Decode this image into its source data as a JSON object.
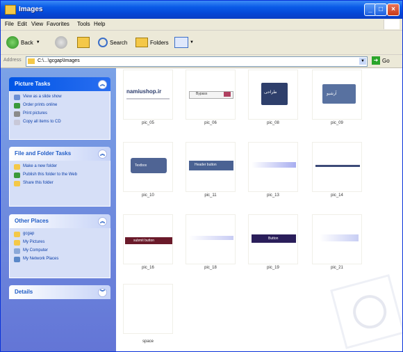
{
  "window": {
    "title": "Images"
  },
  "menu": [
    "File",
    "Edit",
    "View",
    "Favorites",
    "Tools",
    "Help"
  ],
  "toolbar": {
    "back": "Back",
    "search": "Search",
    "folders": "Folders"
  },
  "address": {
    "label": "Address",
    "path": "C:\\...\\gcgap\\Images",
    "go": "Go"
  },
  "sidebar": {
    "picture_tasks": {
      "title": "Picture Tasks",
      "items": [
        "View as a slide show",
        "Order prints online",
        "Print pictures",
        "Copy all items to CD"
      ]
    },
    "file_tasks": {
      "title": "File and Folder Tasks",
      "items": [
        "Make a new folder",
        "Publish this folder to the Web",
        "Share this folder"
      ]
    },
    "other_places": {
      "title": "Other Places",
      "items": [
        "gcgap",
        "My Pictures",
        "My Computer",
        "My Network Places"
      ]
    },
    "details": {
      "title": "Details"
    }
  },
  "files": [
    {
      "name": "pic_05",
      "thumb_text": "namiushop.ir"
    },
    {
      "name": "pic_06",
      "thumb_text": "Bypass"
    },
    {
      "name": "pic_08",
      "thumb_text": "طراحی"
    },
    {
      "name": "pic_09",
      "thumb_text": "آرشیو"
    },
    {
      "name": "pic_10",
      "thumb_text": "Textbox"
    },
    {
      "name": "pic_11",
      "thumb_text": "Header button"
    },
    {
      "name": "pic_13",
      "thumb_text": ""
    },
    {
      "name": "pic_14",
      "thumb_text": ""
    },
    {
      "name": "pic_16",
      "thumb_text": "submit button"
    },
    {
      "name": "pic_18",
      "thumb_text": ""
    },
    {
      "name": "pic_19",
      "thumb_text": "Button"
    },
    {
      "name": "pic_21",
      "thumb_text": ""
    },
    {
      "name": "space",
      "thumb_text": ""
    }
  ],
  "colors": {
    "title_bar": "#0a5be8",
    "sidebar_bg": "#6f8ee0",
    "panel_body": "#d6dff7",
    "link": "#0b3ea8"
  }
}
